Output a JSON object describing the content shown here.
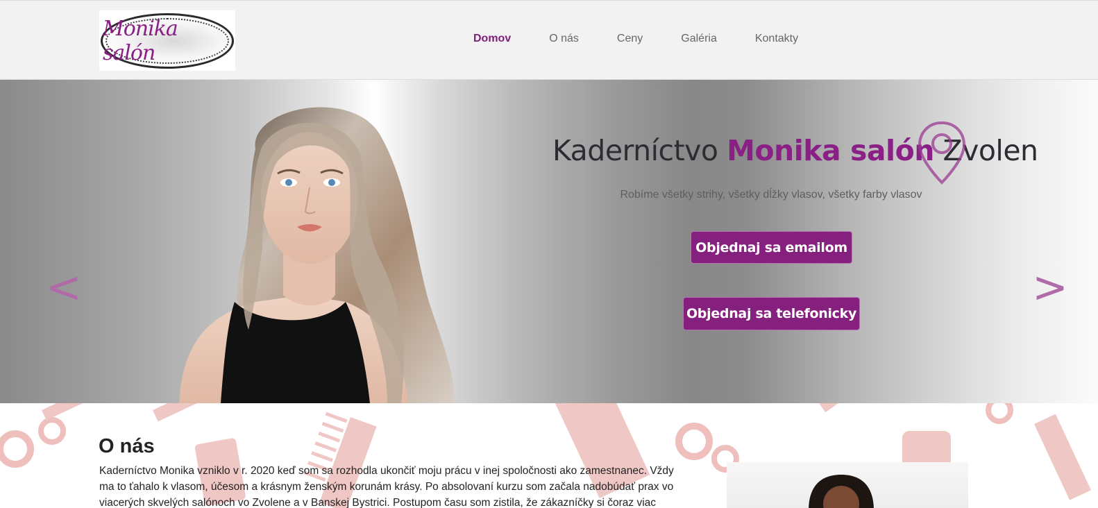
{
  "logo": {
    "text": "Monika salón"
  },
  "nav": {
    "items": [
      {
        "label": "Domov",
        "active": true
      },
      {
        "label": "O nás",
        "active": false
      },
      {
        "label": "Ceny",
        "active": false
      },
      {
        "label": "Galéria",
        "active": false
      },
      {
        "label": "Kontakty",
        "active": false
      }
    ]
  },
  "hero": {
    "title_pre": "Kaderníctvo ",
    "title_brand": "Monika salón",
    "title_post": " Zvolen",
    "subtitle": "Robíme všetky strihy, všetky dĺžky vlasov, všetky farby vlasov",
    "btn_email": "Objednaj sa emailom",
    "btn_phone": "Objednaj sa telefonicky",
    "prev_arrow": "<",
    "next_arrow": ">"
  },
  "about": {
    "title": "O nás",
    "text": "Kaderníctvo Monika vzniklo v r. 2020 keď som sa rozhodla ukončiť moju prácu v inej spoločnosti ako zamestnanec. Vždy ma to ťahalo k vlasom, účesom a krásnym ženským korunám krásy. Po absolovaní kurzu som začala nadobúdať prax vo viacerých skvelých salónoch vo Zvolene a v Banskej Bystrici. Postupom času som zistila, že zákazníčky si čoraz viac žiadali"
  },
  "colors": {
    "brand": "#8a1f86",
    "button": "#86207f",
    "nav_bg": "#f2f2f2",
    "pattern": "#e8aaa6"
  },
  "icons": {
    "pin": "location-pin-icon",
    "prev": "chevron-left-icon",
    "next": "chevron-right-icon"
  }
}
